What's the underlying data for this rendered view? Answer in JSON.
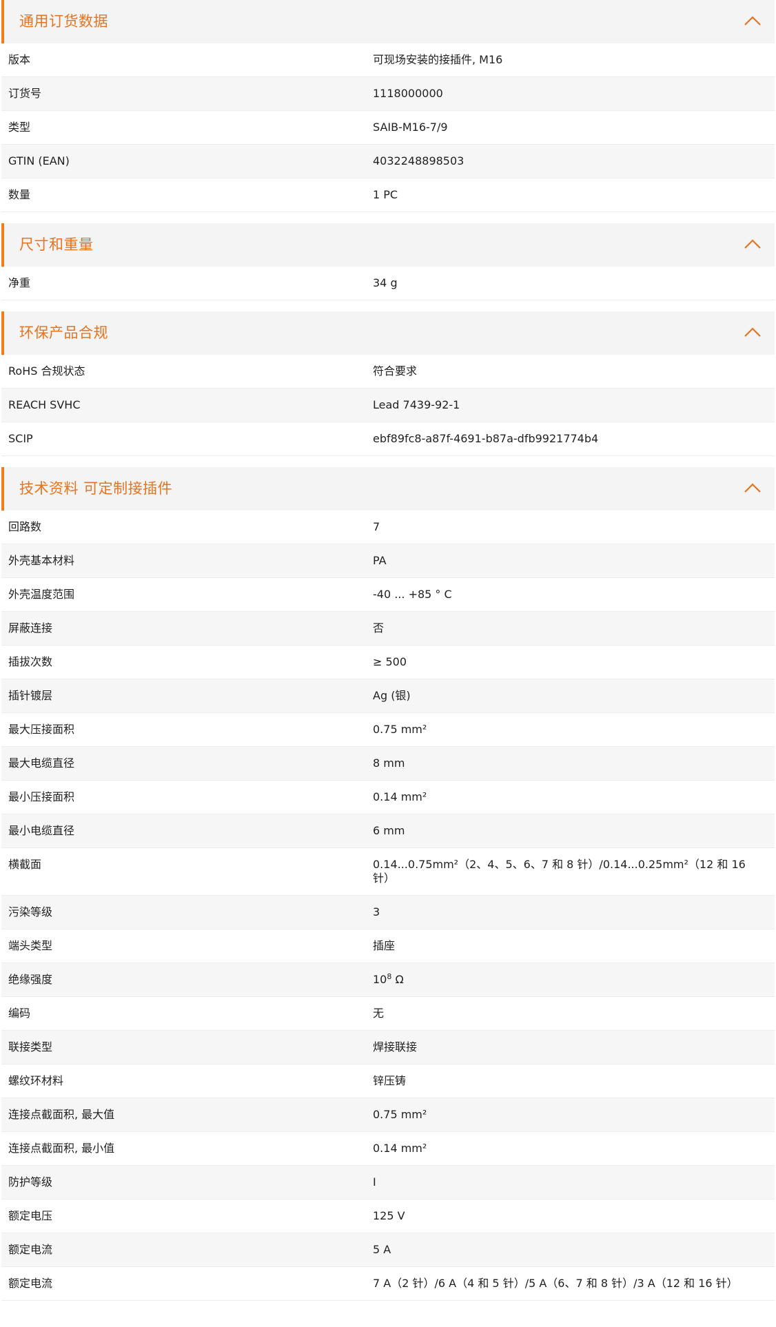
{
  "sections": [
    {
      "title": "通用订货数据",
      "rows": [
        {
          "label": "版本",
          "value": "可现场安装的接插件, M16"
        },
        {
          "label": "订货号",
          "value": "1118000000"
        },
        {
          "label": "类型",
          "value": "SAIB-M16-7/9"
        },
        {
          "label": "GTIN (EAN)",
          "value": "4032248898503"
        },
        {
          "label": "数量",
          "value": "1  PC"
        }
      ]
    },
    {
      "title": "尺寸和重量",
      "rows": [
        {
          "label": "净重",
          "value": "34  g"
        }
      ]
    },
    {
      "title": "环保产品合规",
      "rows": [
        {
          "label": "RoHS 合规状态",
          "value": "符合要求"
        },
        {
          "label": "REACH SVHC",
          "value": "Lead 7439-92-1"
        },
        {
          "label": "SCIP",
          "value": "ebf89fc8-a87f-4691-b87a-dfb9921774b4"
        }
      ]
    },
    {
      "title": "技术资料 可定制接插件",
      "rows": [
        {
          "label": "回路数",
          "value": "7"
        },
        {
          "label": "外壳基本材料",
          "value": "PA"
        },
        {
          "label": "外壳温度范围",
          "value": "-40 ... +85 ° C"
        },
        {
          "label": "屏蔽连接",
          "value": "否"
        },
        {
          "label": "插拔次数",
          "value": "≥ 500"
        },
        {
          "label": "插针镀层",
          "value": "Ag (银)"
        },
        {
          "label": "最大压接面积",
          "value": "0.75  mm²"
        },
        {
          "label": "最大电缆直径",
          "value": "8  mm"
        },
        {
          "label": "最小压接面积",
          "value": "0.14  mm²"
        },
        {
          "label": "最小电缆直径",
          "value": "6  mm"
        },
        {
          "label": "横截面",
          "value": "0.14...0.75mm²（2、4、5、6、7 和 8 针）/0.14...0.25mm²（12 和 16 针）"
        },
        {
          "label": "污染等级",
          "value": "3"
        },
        {
          "label": "端头类型",
          "value": "插座"
        },
        {
          "label": "绝缘强度",
          "value_base": "10",
          "value_sup": "8",
          "value_unit": " Ω"
        },
        {
          "label": "编码",
          "value": "无"
        },
        {
          "label": "联接类型",
          "value": "焊接联接"
        },
        {
          "label": "螺纹环材料",
          "value": "锌压铸"
        },
        {
          "label": "连接点截面积, 最大值",
          "value": "0.75  mm²"
        },
        {
          "label": "连接点截面积, 最小值",
          "value": "0.14  mm²"
        },
        {
          "label": "防护等级",
          "value": "I"
        },
        {
          "label": "额定电压",
          "value": "125  V"
        },
        {
          "label": "额定电流",
          "value": "5  A"
        },
        {
          "label": "额定电流",
          "value": "7 A（2 针）/6 A（4 和 5 针）/5 A（6、7 和 8 针）/3 A（12 和 16 针）"
        }
      ]
    }
  ],
  "icons": {
    "collapse": "chevron-up-icon"
  },
  "colors": {
    "accent": "#e8731e",
    "header_bg": "#f4f4f4",
    "row_alt": "#f6f6f6"
  }
}
